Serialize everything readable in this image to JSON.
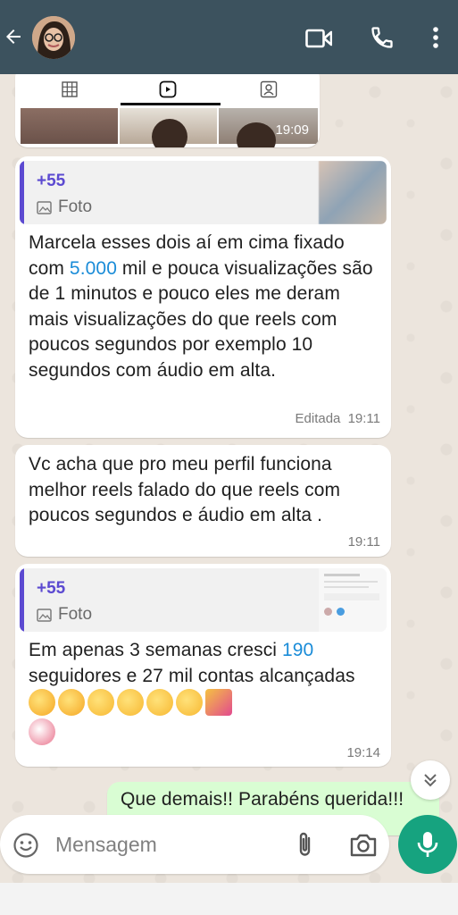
{
  "header": {
    "back_icon": "arrow-left-icon",
    "video_icon": "video-camera-icon",
    "call_icon": "phone-icon",
    "menu_icon": "more-vertical-icon",
    "background_color": "#3c525e"
  },
  "reels_preview": {
    "tabs": [
      "grid-icon",
      "reels-icon",
      "tagged-icon"
    ],
    "time": "19:09"
  },
  "messages": [
    {
      "quote": {
        "sender": "+55",
        "type": "Foto"
      },
      "text_before_link": "Marcela esses dois aí em cima fixado com ",
      "link_text": "5.000",
      "text_after_link": " mil e pouca visualizações são de 1 minutos e pouco eles me deram mais visualizações do que reels com poucos segundos por exemplo 10 segundos com áudio em alta.",
      "edited_label": "Editada",
      "time": "19:11"
    },
    {
      "text": "Vc acha que pro meu perfil funciona melhor reels falado do que reels com poucos segundos e áudio em alta .",
      "time": "19:11"
    },
    {
      "quote": {
        "sender": "+55",
        "type": "Foto"
      },
      "text_before_link": "Em apenas 3 semanas cresci ",
      "link_text": "190",
      "text_after_link": " seguidores e 27 mil contas alcançadas",
      "emojis": [
        "partying-face-emoji",
        "partying-face-emoji",
        "pleading-face-emoji",
        "pleading-face-emoji",
        "star-struck-emoji",
        "star-struck-emoji",
        "party-popper-emoji",
        "confetti-ball-emoji"
      ],
      "time": "19:14"
    }
  ],
  "outgoing_preview": {
    "text": "Que demais!! Parabéns querida!!!"
  },
  "input": {
    "placeholder": "Mensagem"
  },
  "colors": {
    "accent_purple": "#5c4ad1",
    "link_blue": "#1a8cd8",
    "mic_green": "#16a37f",
    "outgoing_bubble": "#d9fdd3"
  }
}
